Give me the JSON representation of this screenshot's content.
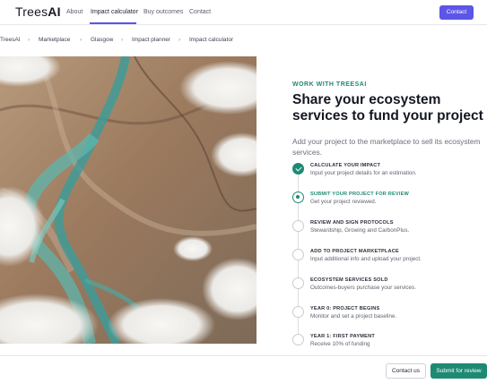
{
  "brand": {
    "logo_prefix": "Trees",
    "logo_suffix": "AI"
  },
  "nav": {
    "links": [
      "About",
      "Impact calculator",
      "Buy outcomes",
      "Contact"
    ],
    "active": "Impact calculator",
    "cta_label": "Contact"
  },
  "breadcrumb": [
    "TreesAI",
    "Marketplace",
    "Glasgow",
    "Impact planner",
    "Impact calculator"
  ],
  "hero": {
    "image_subject": "aerial-river-landscape",
    "eyebrow": "WORK WITH TREESAI",
    "headline": "Share your ecosystem services to fund your project",
    "subline": "Add your project to the marketplace to sell its ecosystem services."
  },
  "steps": [
    {
      "title": "CALCULATE YOUR IMPACT",
      "desc": "Input your project details for an estimation.",
      "state": "done"
    },
    {
      "title": "SUBMIT YOUR PROJECT FOR REVIEW",
      "desc": "Get your project reviewed.",
      "state": "current"
    },
    {
      "title": "REVIEW AND SIGN PROTOCOLS",
      "desc": "Stewardship, Growing and CarbonPlus.",
      "state": "todo"
    },
    {
      "title": "ADD TO PROJECT MARKETPLACE",
      "desc": "Input additional info and upload your project.",
      "state": "todo"
    },
    {
      "title": "ECOSYSTEM SERVICES SOLD",
      "desc": "Outcomes-buyers purchase your services.",
      "state": "todo"
    },
    {
      "title": "YEAR 0: PROJECT BEGINS",
      "desc": "Monitor and set a project baseline.",
      "state": "todo"
    },
    {
      "title": "YEAR 1: FIRST PAYMENT",
      "desc": "Receive 10% of funding",
      "state": "todo"
    }
  ],
  "footer": {
    "secondary_label": "Contact us",
    "primary_label": "Submit for review"
  },
  "colors": {
    "accent_purple": "#5c55e6",
    "accent_green": "#1e8a73"
  }
}
